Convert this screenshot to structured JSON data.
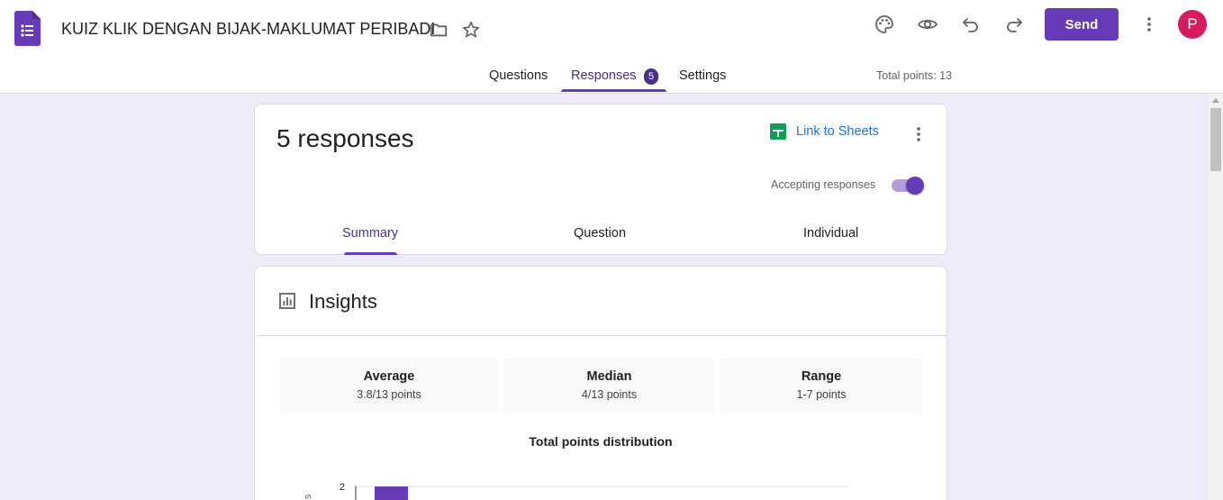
{
  "app": {
    "title": "KUIZ KLIK DENGAN BIJAK-MAKLUMAT PERIBADI",
    "brand_color": "#673ab7",
    "send_label": "Send",
    "avatar_letter": "P"
  },
  "tabs": [
    {
      "label": "Questions"
    },
    {
      "label": "Responses",
      "badge": "5"
    },
    {
      "label": "Settings"
    }
  ],
  "total_points": "Total points: 13",
  "responses_card": {
    "count_label": "5 responses",
    "link_sheets": "Link to Sheets",
    "accepting_label": "Accepting responses",
    "accepting_on": true,
    "sub_tabs": [
      "Summary",
      "Question",
      "Individual"
    ]
  },
  "insights": {
    "title": "Insights",
    "stats": [
      {
        "label": "Average",
        "value": "3.8/13 points"
      },
      {
        "label": "Median",
        "value": "4/13 points"
      },
      {
        "label": "Range",
        "value": "1-7 points"
      }
    ],
    "chart_title": "Total points distribution"
  },
  "chart_data": {
    "type": "bar",
    "title": "Total points distribution",
    "y_tick_visible": "2",
    "ylabel_visible_fragment": "s",
    "bar_color": "#673ab7"
  }
}
